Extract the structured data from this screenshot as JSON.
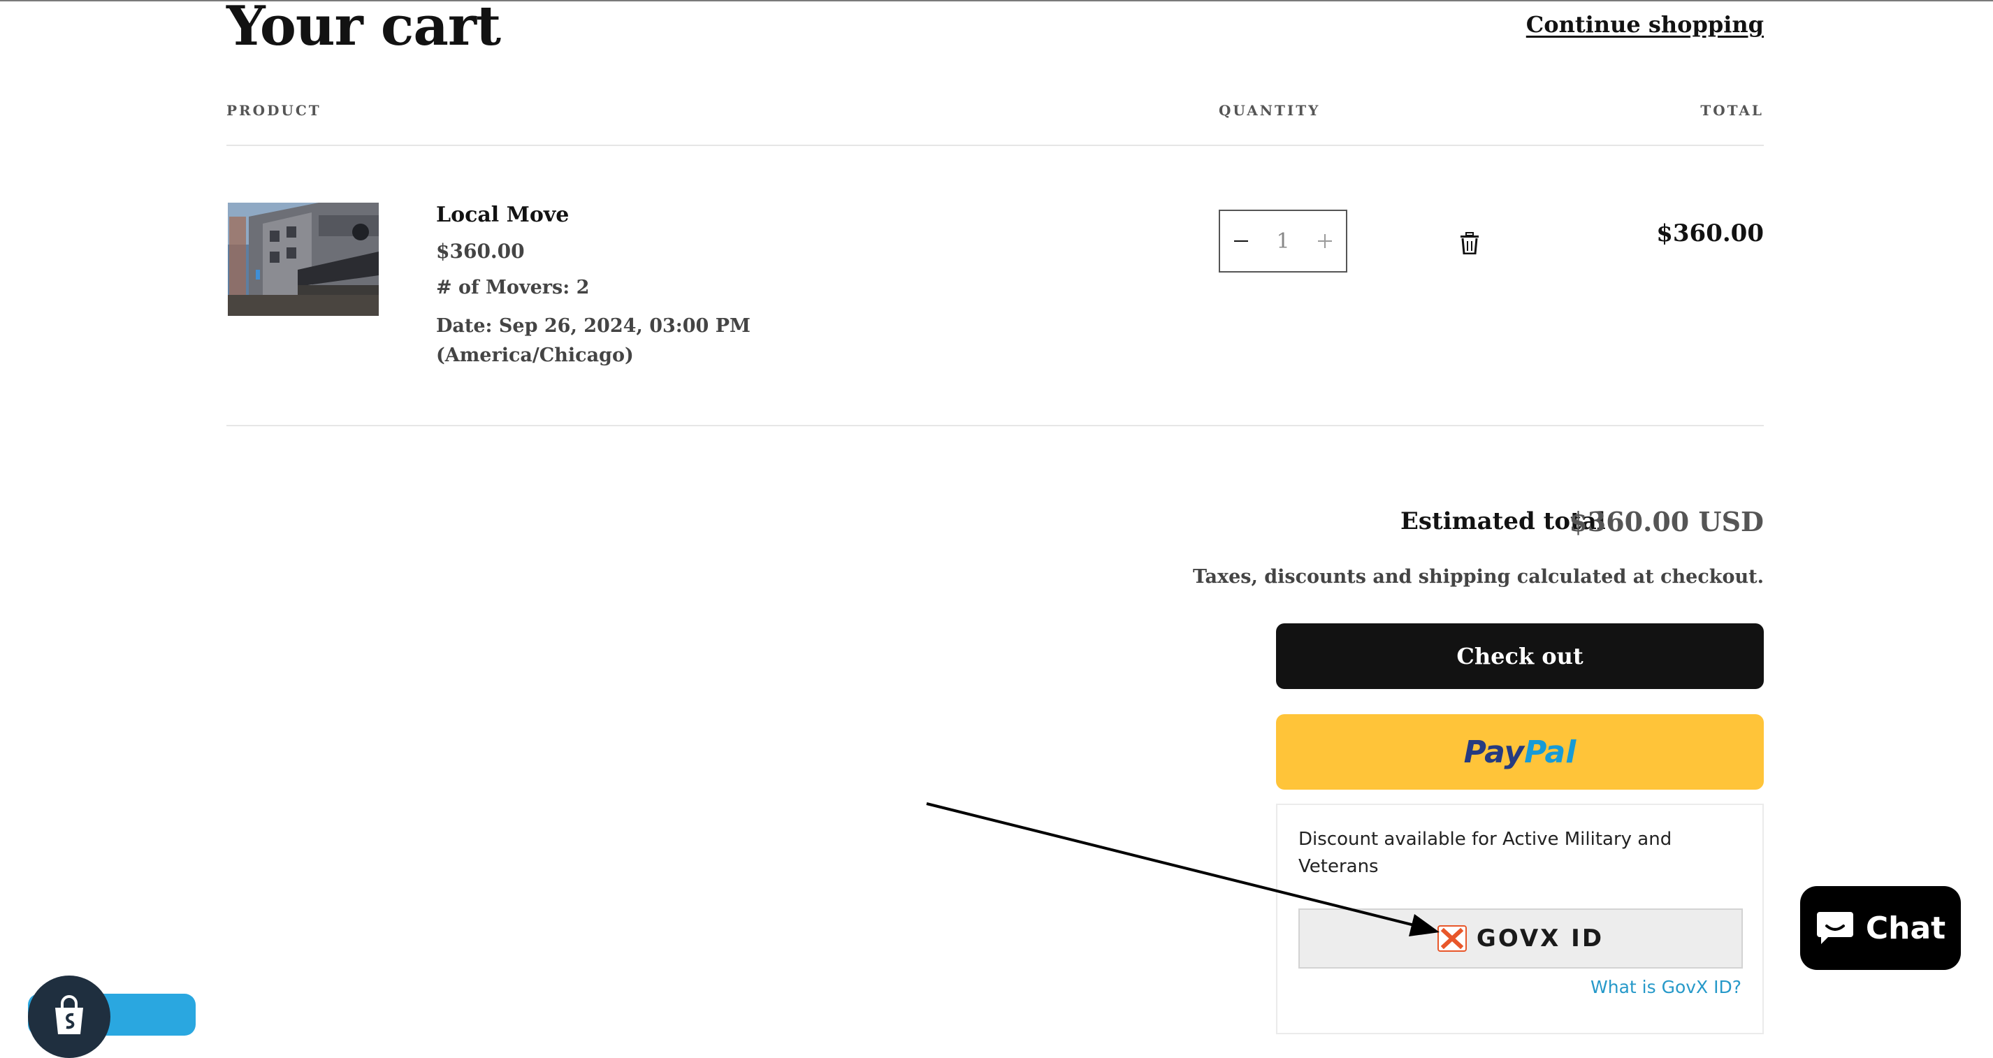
{
  "cart": {
    "title": "Your cart",
    "continue_link": "Continue shopping",
    "columns": {
      "product": "PRODUCT",
      "quantity": "QUANTITY",
      "total": "TOTAL"
    },
    "items": [
      {
        "name": "Local Move",
        "price": "$360.00",
        "option": "# of Movers: 2",
        "date": "Date: Sep 26, 2024, 03:00 PM (America/Chicago)",
        "quantity": "1",
        "line_total": "$360.00"
      }
    ]
  },
  "summary": {
    "estimated_label": "Estimated total",
    "estimated_value": "$360.00 USD",
    "tax_note": "Taxes, discounts and shipping calculated at checkout.",
    "checkout_label": "Check out",
    "paypal": {
      "part1": "Pay",
      "part2": "Pal"
    }
  },
  "govx": {
    "discount_text": "Discount available for Active Military and Veterans",
    "button_label": "GOVX ID",
    "link_text": "What is GovX ID?"
  },
  "chat": {
    "label": "Chat"
  },
  "colors": {
    "accent_dark": "#121212",
    "paypal_yellow": "#ffc439",
    "govx_orange": "#e8572a",
    "link_blue": "#2699c9"
  },
  "icons": [
    "minus-icon",
    "plus-icon",
    "trash-icon",
    "govx-logo-icon",
    "chat-bubble-icon",
    "shop-bag-icon"
  ]
}
